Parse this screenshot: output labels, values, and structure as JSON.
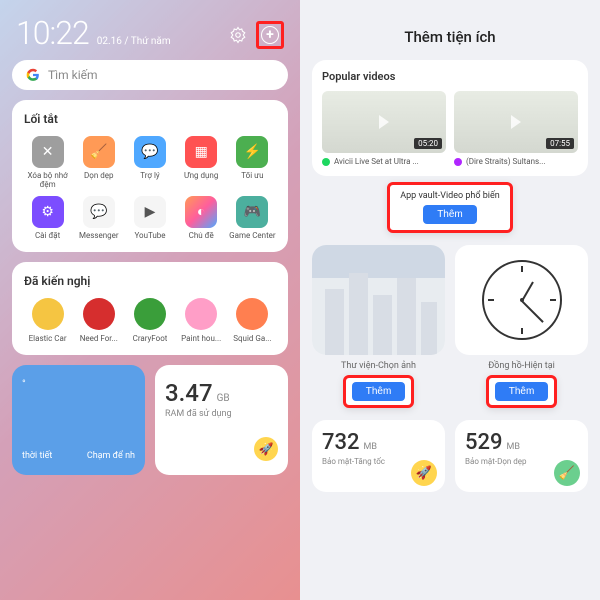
{
  "left": {
    "time": "10:22",
    "date": "02.16 / Thứ năm",
    "search_placeholder": "Tìm kiếm",
    "shortcuts_title": "Lối tắt",
    "shortcuts": [
      {
        "label": "Xóa bộ nhớ đệm",
        "bg": "ic-gray",
        "glyph": "✕"
      },
      {
        "label": "Dọn dẹp",
        "bg": "ic-orange",
        "glyph": "🧹"
      },
      {
        "label": "Trợ lý",
        "bg": "ic-blue",
        "glyph": "💬"
      },
      {
        "label": "Ứng dụng",
        "bg": "ic-red",
        "glyph": "▦"
      },
      {
        "label": "Tối ưu",
        "bg": "ic-green",
        "glyph": "⚡"
      },
      {
        "label": "Cài đặt",
        "bg": "ic-purple",
        "glyph": "⚙"
      },
      {
        "label": "Messenger",
        "bg": "ic-white",
        "glyph": "💬"
      },
      {
        "label": "YouTube",
        "bg": "ic-white",
        "glyph": "▶"
      },
      {
        "label": "Chủ đề",
        "bg": "ic-grad",
        "glyph": "◐"
      },
      {
        "label": "Game Center",
        "bg": "ic-game",
        "glyph": "🎮"
      }
    ],
    "recs_title": "Đã kiến nghị",
    "recs": [
      {
        "label": "Elastic Car",
        "color": "#f5c542"
      },
      {
        "label": "Need For...",
        "color": "#d62e2e"
      },
      {
        "label": "CraryFoot",
        "color": "#3a9e3a"
      },
      {
        "label": "Paint hou...",
        "color": "#ff9ec7"
      },
      {
        "label": "Squid Ga...",
        "color": "#ff7f50"
      }
    ],
    "weather": {
      "empty": "°",
      "city": "thời tiết",
      "action": "Chạm để nh"
    },
    "ram": {
      "value": "3.47",
      "unit": "GB",
      "label": "RAM đã sử dụng"
    }
  },
  "right": {
    "title": "Thêm tiện ích",
    "popular_title": "Popular videos",
    "videos": [
      {
        "title": "Avicii Live Set at Ultra ...",
        "dur": "05:20",
        "dot": "#1ed760"
      },
      {
        "title": "(Dire Straits) Sultans...",
        "dur": "07:55",
        "dot": "#b026ff"
      }
    ],
    "addbox1_label": "App vault-Video phổ biến",
    "add_btn": "Thêm",
    "widget_labels": [
      "Thư viện-Chọn ảnh",
      "Đồng hồ-Hiện tại"
    ],
    "stats": [
      {
        "value": "732",
        "unit": "MB",
        "label": "Bảo mật-Tăng tốc",
        "iconbg": "#ffd54f",
        "icon": "🚀"
      },
      {
        "value": "529",
        "unit": "MB",
        "label": "Bảo mật-Dọn dẹp",
        "iconbg": "#6bcf8e",
        "icon": "🧹"
      }
    ]
  }
}
